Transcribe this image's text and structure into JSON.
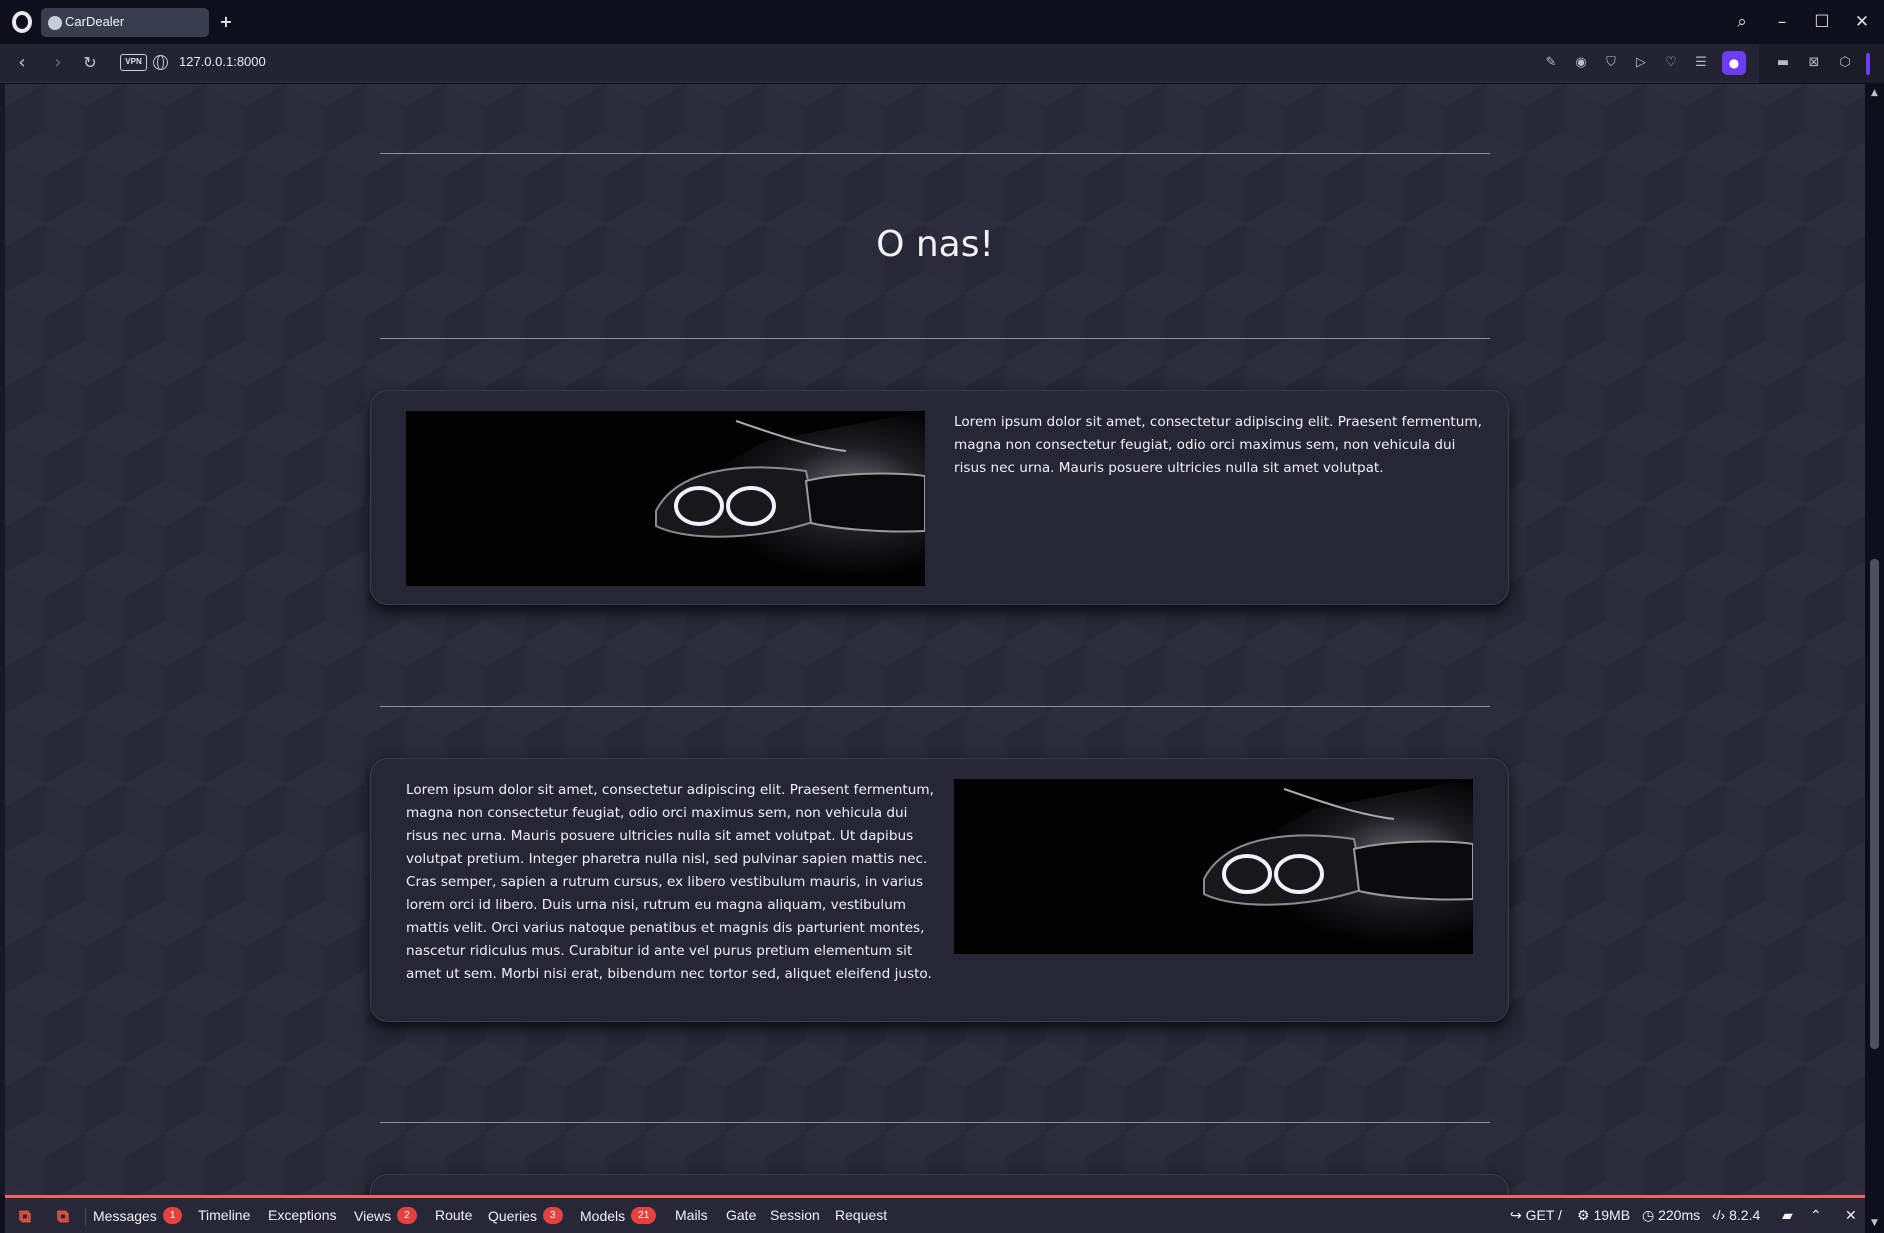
{
  "browser": {
    "tab_title": "CarDealer",
    "url": "127.0.0.1:8000",
    "vpn_label": "VPN"
  },
  "page": {
    "heading": "O nas!",
    "cards": [
      {
        "text": "Lorem ipsum dolor sit amet, consectetur adipiscing elit. Praesent fermentum, magna non consectetur feugiat, odio orci maximus sem, non vehicula dui risus nec urna. Mauris posuere ultricies nulla sit amet volutpat."
      },
      {
        "text": "Lorem ipsum dolor sit amet, consectetur adipiscing elit. Praesent fermentum, magna non consectetur feugiat, odio orci maximus sem, non vehicula dui risus nec urna. Mauris posuere ultricies nulla sit amet volutpat. Ut dapibus volutpat pretium. Integer pharetra nulla nisl, sed pulvinar sapien mattis nec. Cras semper, sapien a rutrum cursus, ex libero vestibulum mauris, in varius lorem orci id libero. Duis urna nisi, rutrum eu magna aliquam, vestibulum mattis velit. Orci varius natoque penatibus et magnis dis parturient montes, nascetur ridiculus mus. Curabitur id ante vel purus pretium elementum sit amet ut sem. Morbi nisi erat, bibendum nec tortor sed, aliquet eleifend justo."
      }
    ]
  },
  "debugbar": {
    "items": [
      {
        "label": "Messages",
        "badge": "1"
      },
      {
        "label": "Timeline",
        "badge": ""
      },
      {
        "label": "Exceptions",
        "badge": ""
      },
      {
        "label": "Views",
        "badge": "2"
      },
      {
        "label": "Route",
        "badge": ""
      },
      {
        "label": "Queries",
        "badge": "3"
      },
      {
        "label": "Models",
        "badge": "21"
      },
      {
        "label": "Mails",
        "badge": ""
      },
      {
        "label": "Gate",
        "badge": ""
      },
      {
        "label": "Session",
        "badge": ""
      },
      {
        "label": "Request",
        "badge": ""
      }
    ],
    "method_route": "GET /",
    "memory": "19MB",
    "time": "220ms",
    "php_version": "8.2.4"
  },
  "colors": {
    "accent": "#6d3cf5",
    "debugbar_accent": "#f4645f",
    "badge": "#e5413f",
    "background": "#262837",
    "card": "#252736"
  }
}
